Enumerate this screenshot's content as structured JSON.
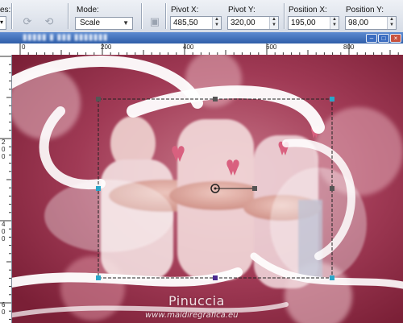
{
  "toolbar": {
    "partial_label": "es:",
    "mode_label": "Mode:",
    "mode_value": "Scale",
    "pivot_x_label": "Pivot X:",
    "pivot_x_value": "485,50",
    "pivot_y_label": "Pivot Y:",
    "pivot_y_value": "320,00",
    "position_x_label": "Position X:",
    "position_x_value": "195,00",
    "position_y_label": "Position Y:",
    "position_y_value": "98,00"
  },
  "ruler": {
    "top_ticks": [
      "0",
      "200",
      "400",
      "600",
      "800"
    ],
    "left_ticks": [
      "2",
      "0",
      "0",
      "4",
      "0",
      "0",
      "6",
      "0"
    ]
  },
  "canvas": {
    "watermark_title": "Pinuccia",
    "watermark_url": "www.maidiregrafica.eu"
  },
  "colors": {
    "background": "#8d2a41",
    "accent_handle": "#2aa6c9",
    "handle": "#555555",
    "pink_ribbon": "#d9607f"
  },
  "icons": {
    "mode_dropdown": "chevron-down-icon",
    "spinner_up": "spin-up-icon",
    "spinner_down": "spin-down-icon"
  }
}
